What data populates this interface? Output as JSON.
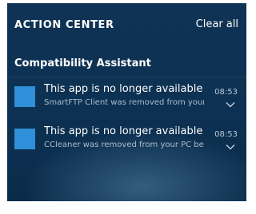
{
  "action_center": {
    "title": "ACTION CENTER",
    "clear_all_label": "Clear all"
  },
  "group": {
    "name": "Compatibility Assistant",
    "notifications": [
      {
        "title": "This app is no longer available",
        "body": "SmartFTP Client was removed from your PC because it isn't compatible with this version of Windows.",
        "time": "08:53",
        "icon": "app-tile-icon",
        "expand_icon": "chevron-down-icon"
      },
      {
        "title": "This app is no longer available",
        "body": "CCleaner was removed from your PC because it isn't compatible with this version of Windows.",
        "time": "08:53",
        "icon": "app-tile-icon",
        "expand_icon": "chevron-down-icon"
      }
    ]
  },
  "colors": {
    "panel_background": "#0d3152",
    "app_icon": "#2f8fd8",
    "text_primary": "#ffffff",
    "text_secondary": "#a9bccd"
  }
}
